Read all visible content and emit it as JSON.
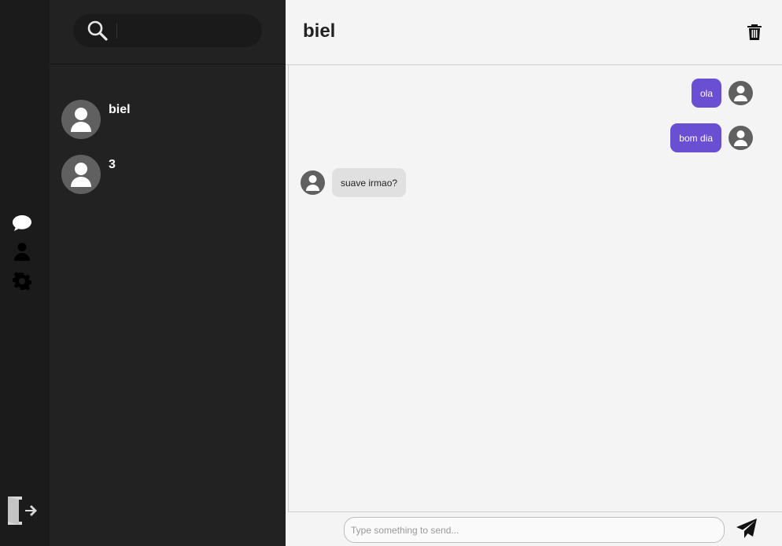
{
  "search": {
    "placeholder": ""
  },
  "contacts": [
    {
      "name": "biel"
    },
    {
      "name": "3"
    }
  ],
  "chat": {
    "title": "biel",
    "messages": [
      {
        "text": "ola",
        "direction": "outgoing"
      },
      {
        "text": "bom dia",
        "direction": "outgoing"
      },
      {
        "text": "suave irmao?",
        "direction": "incoming"
      }
    ],
    "composer_placeholder": "Type something to send..."
  },
  "icons": {
    "rail": [
      "chat-icon",
      "user-icon",
      "gear-icon"
    ],
    "logout": "logout-icon",
    "search": "search-icon",
    "delete": "trash-icon",
    "send": "send-icon"
  },
  "colors": {
    "accent": "#6a4fd2",
    "rail_bg": "#1b1b1b",
    "panel_bg": "#222222",
    "chat_bg": "#f4f4f4",
    "incoming_bubble": "#e0e0e0",
    "avatar_bg": "#606060"
  }
}
